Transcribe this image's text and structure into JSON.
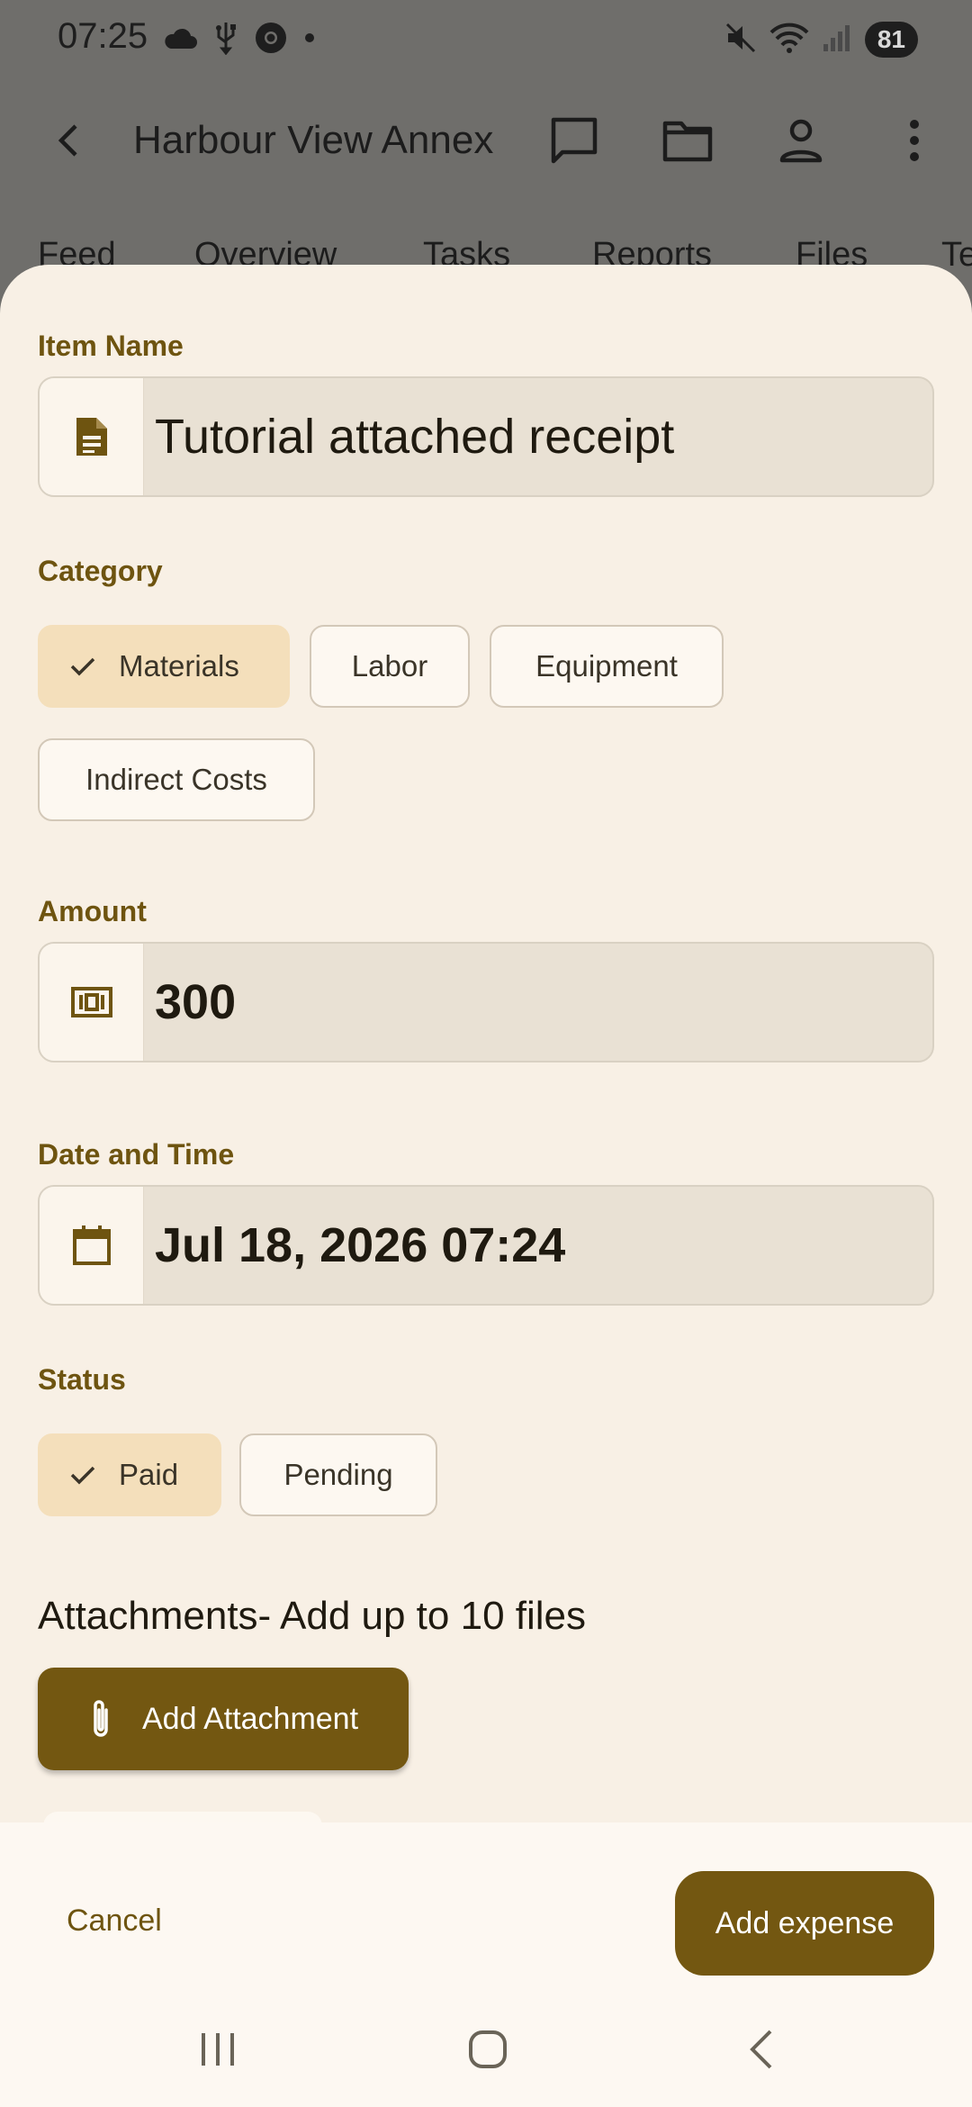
{
  "status_bar": {
    "time": "07:25",
    "battery": "81",
    "icons_left": [
      "cloud-icon",
      "usb-icon",
      "chrome-icon",
      "dot-icon"
    ],
    "icons_right": [
      "mute-icon",
      "wifi-icon",
      "signal-icon"
    ]
  },
  "app_bar": {
    "title": "Harbour View Annex",
    "icons": [
      "back-arrow-icon",
      "chat-icon",
      "folder-icon",
      "person-icon",
      "more-vert-icon"
    ]
  },
  "tabs": [
    "Feed",
    "Overview",
    "Tasks",
    "Reports",
    "Files",
    "Te"
  ],
  "form": {
    "item_name": {
      "label": "Item Name",
      "value": "Tutorial attached receipt",
      "icon": "document-icon"
    },
    "category": {
      "label": "Category",
      "options": [
        "Materials",
        "Labor",
        "Equipment",
        "Indirect Costs"
      ],
      "selected": "Materials"
    },
    "amount": {
      "label": "Amount",
      "value": "300",
      "icon": "money-icon"
    },
    "date_time": {
      "label": "Date and Time",
      "value": "Jul 18, 2026 07:24",
      "icon": "calendar-icon"
    },
    "status": {
      "label": "Status",
      "options": [
        "Paid",
        "Pending"
      ],
      "selected": "Paid"
    },
    "attachments": {
      "title": "Attachments- Add up to 10 files",
      "button_label": "Add Attachment"
    }
  },
  "actions": {
    "cancel_label": "Cancel",
    "submit_label": "Add expense"
  },
  "colors": {
    "accent": "#735711",
    "label": "#6e5410",
    "chip_selected": "#f4dfbb",
    "sheet_bg": "#f8f0e5",
    "scrim": "#6f6e6b"
  }
}
